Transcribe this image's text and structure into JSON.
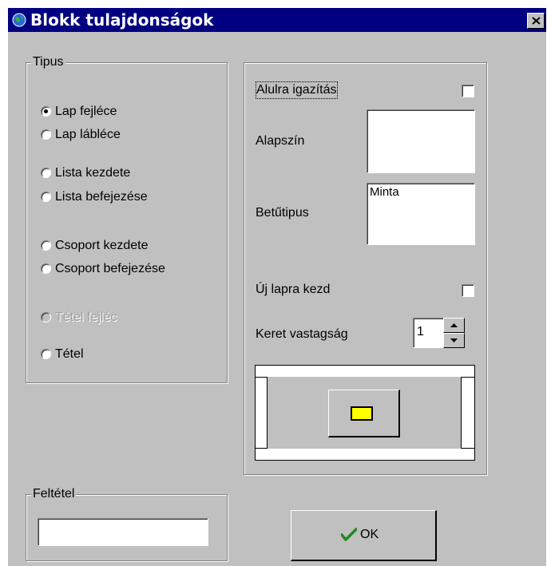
{
  "window": {
    "title": "Blokk tulajdonságok"
  },
  "type_group": {
    "legend": "Tipus",
    "options": [
      {
        "label": "Lap fejléce",
        "selected": true,
        "disabled": false
      },
      {
        "label": "Lap lábléce",
        "selected": false,
        "disabled": false
      },
      {
        "label": "Lista kezdete",
        "selected": false,
        "disabled": false
      },
      {
        "label": "Lista befejezése",
        "selected": false,
        "disabled": false
      },
      {
        "label": "Csoport kezdete",
        "selected": false,
        "disabled": false
      },
      {
        "label": "Csoport befejezése",
        "selected": false,
        "disabled": false
      },
      {
        "label": "Tétel fejléc",
        "selected": false,
        "disabled": true
      },
      {
        "label": "Tétel",
        "selected": false,
        "disabled": false
      }
    ]
  },
  "props": {
    "align_bottom_label": "Alulra igazítás",
    "align_bottom_checked": false,
    "bg_color_label": "Alapszín",
    "bg_color_value": "#ffffff",
    "font_label": "Betűtipus",
    "font_sample": "Minta",
    "new_page_label": "Új lapra kezd",
    "new_page_checked": false,
    "border_label": "Keret vastagság",
    "border_value": "1",
    "preview_swatch_color": "#ffff00"
  },
  "condition_group": {
    "legend": "Feltétel",
    "value": ""
  },
  "ok_button": {
    "label": "OK",
    "icon": "checkmark-icon"
  }
}
